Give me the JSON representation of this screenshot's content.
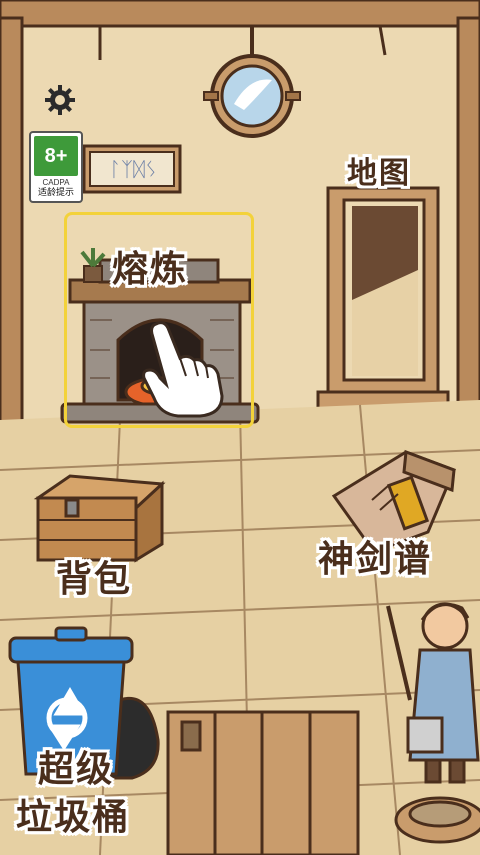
{
  "labels": {
    "smelt": "熔炼",
    "map": "地图",
    "backpack": "背包",
    "sword_manual": "神剑谱",
    "trash_line1": "超级",
    "trash_line2": "垃圾桶"
  },
  "age_rating": {
    "age": "8+",
    "org": "CADPA",
    "caption": "适龄提示",
    "color": "#3e9a3a"
  },
  "sign_text": "ᛚᛉᛞᛊ",
  "icons": {
    "settings": "gear-icon",
    "tutorial_hand": "pointing-hand-icon",
    "recycle": "recycle-icon"
  },
  "colors": {
    "wall": "#e9d6ae",
    "wood": "#b98a5c",
    "outline": "#4a2e1c",
    "trash_blue": "#3a8fd8"
  }
}
